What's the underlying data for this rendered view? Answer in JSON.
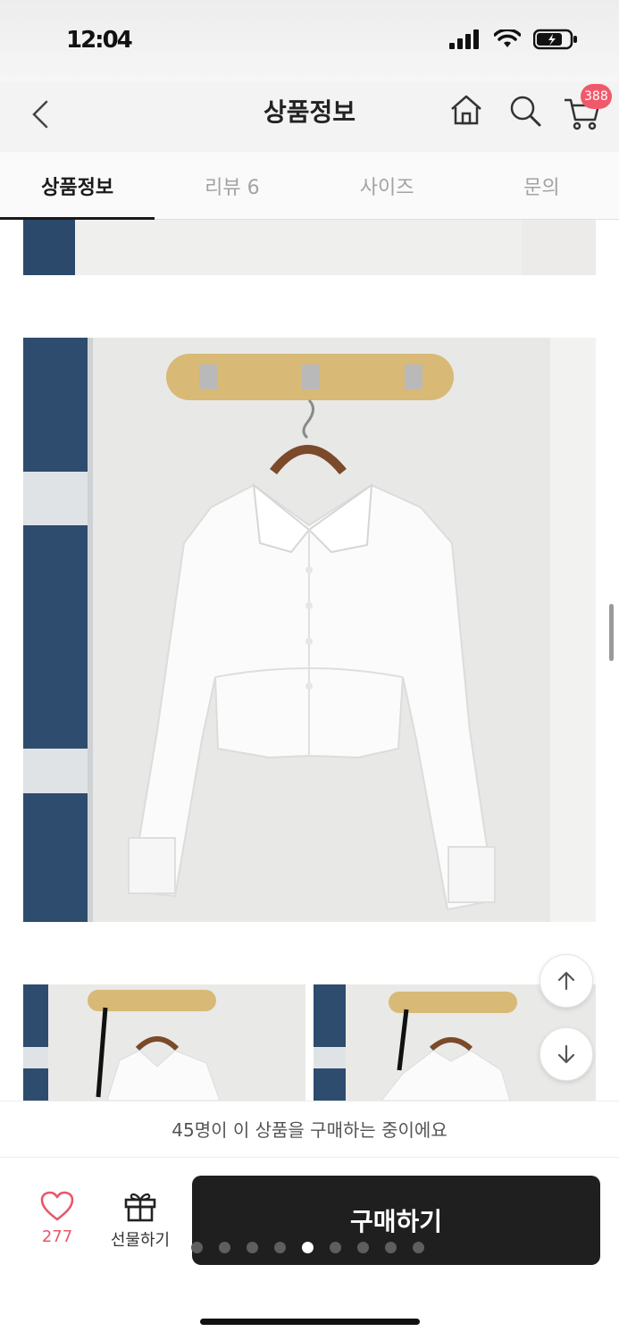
{
  "status_bar": {
    "time": "12:04"
  },
  "header": {
    "title": "상품정보",
    "cart_count": "388"
  },
  "tabs": [
    {
      "label": "상품정보",
      "active": true
    },
    {
      "label": "리뷰 6",
      "active": false
    },
    {
      "label": "사이즈",
      "active": false
    },
    {
      "label": "문의",
      "active": false
    }
  ],
  "notice": {
    "text": "45명이 이 상품을 구매하는 중이에요"
  },
  "bottom_bar": {
    "like_count": "277",
    "gift_label": "선물하기",
    "buy_label": "구매하기"
  },
  "carousel": {
    "total": 9,
    "active_index": 4
  },
  "colors": {
    "accent_pink": "#f0596c",
    "buy_button": "#1f1f1f"
  },
  "icons": [
    "back-icon",
    "home-icon",
    "search-icon",
    "cart-icon",
    "heart-icon",
    "gift-icon",
    "arrow-up-icon",
    "arrow-down-icon"
  ]
}
